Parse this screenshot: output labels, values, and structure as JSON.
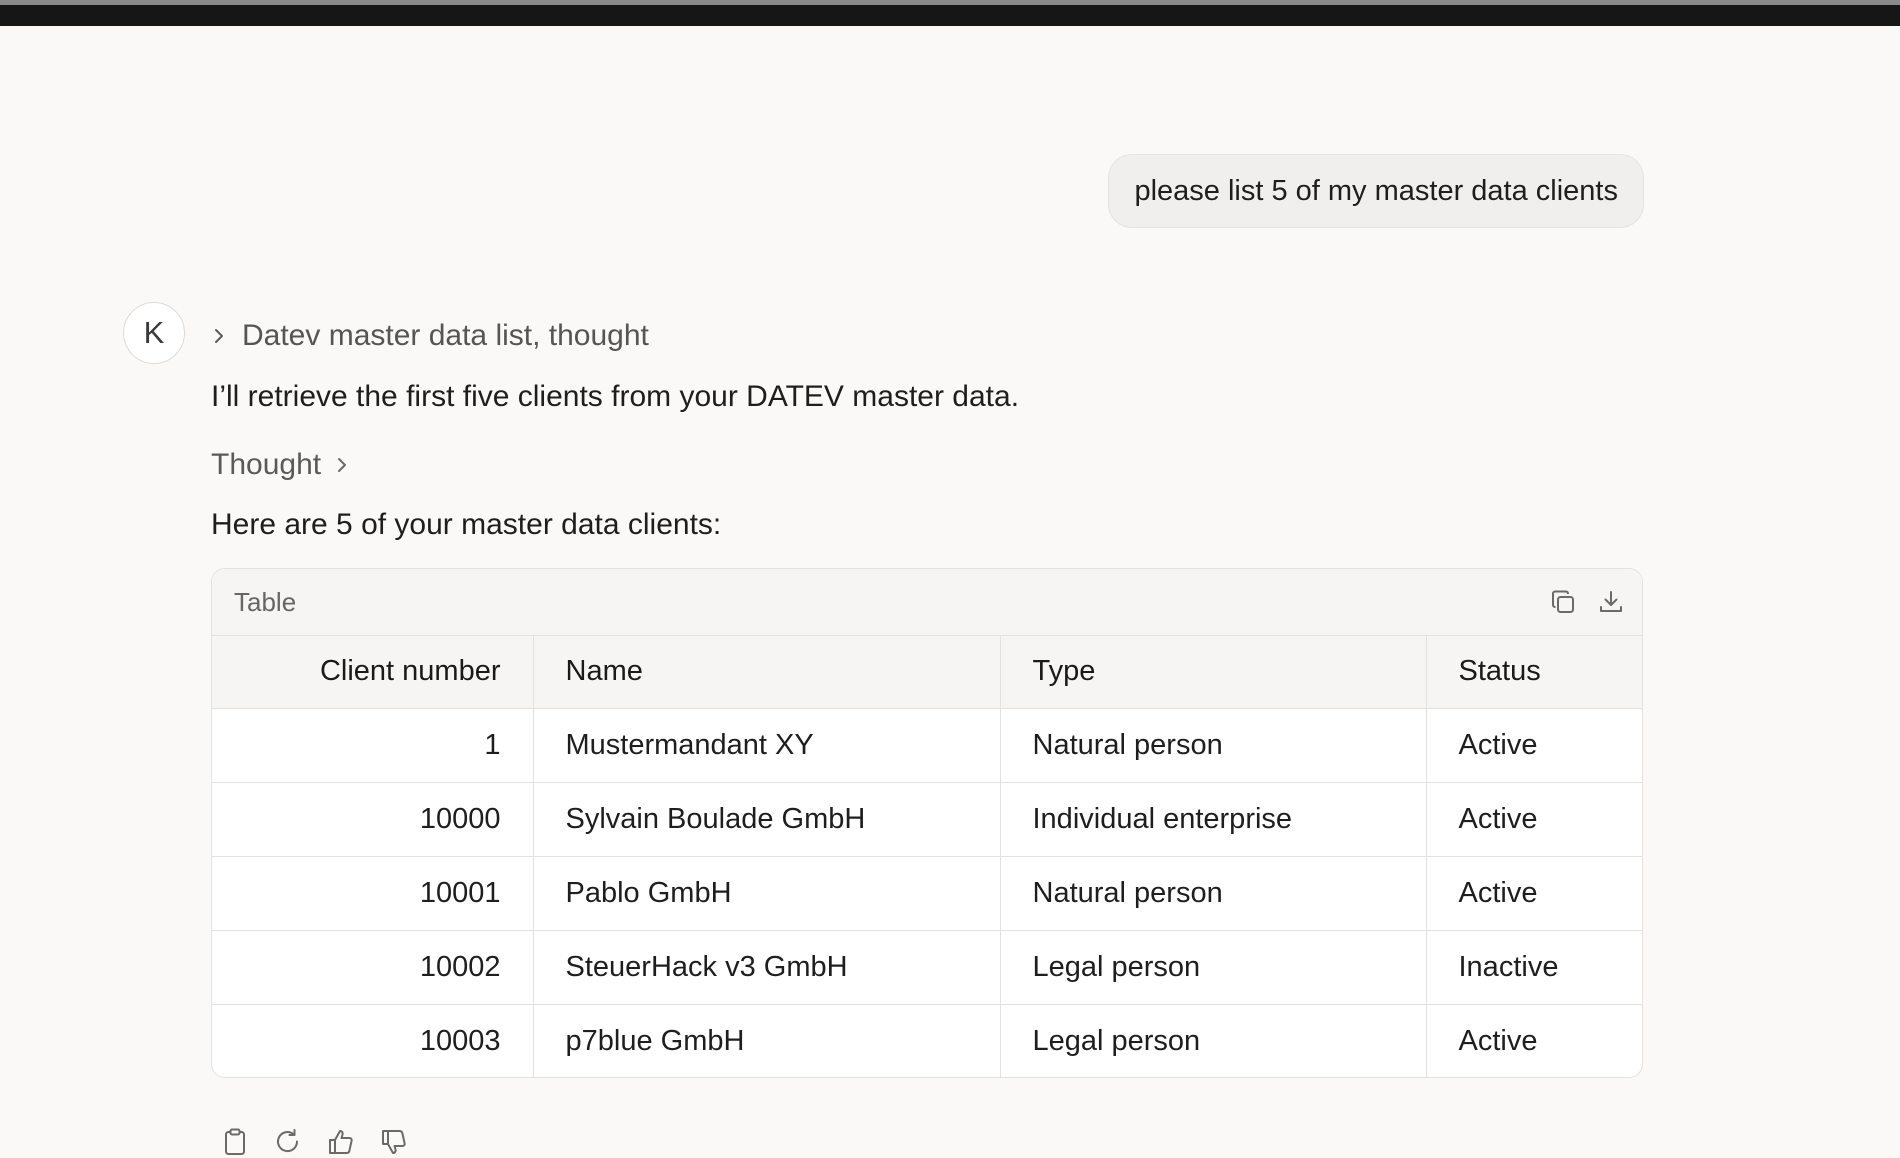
{
  "user_message": "please list 5 of my master data clients",
  "assistant": {
    "avatar_initial": "K",
    "tool_summary": "Datev master data list, thought",
    "intro_text": "I’ll retrieve the first five clients from your DATEV master data.",
    "thought_label": "Thought",
    "result_text": "Here are 5 of your master data clients:",
    "table": {
      "title": "Table",
      "columns": [
        "Client number",
        "Name",
        "Type",
        "Status"
      ],
      "rows": [
        {
          "client_number": "1",
          "name": "Mustermandant XY",
          "type": "Natural person",
          "status": "Active"
        },
        {
          "client_number": "10000",
          "name": "Sylvain Boulade GmbH",
          "type": "Individual enterprise",
          "status": "Active"
        },
        {
          "client_number": "10001",
          "name": "Pablo GmbH",
          "type": "Natural person",
          "status": "Active"
        },
        {
          "client_number": "10002",
          "name": "SteuerHack v3 GmbH",
          "type": "Legal person",
          "status": "Inactive"
        },
        {
          "client_number": "10003",
          "name": "p7blue GmbH",
          "type": "Legal person",
          "status": "Active"
        }
      ]
    },
    "feedback_icons": [
      "clipboard-icon",
      "retry-icon",
      "thumbs-up-icon",
      "thumbs-down-icon"
    ]
  },
  "colors": {
    "background": "#faf9f8",
    "topbar": "#161616",
    "border": "#e3e2df",
    "text": "#1e1e1e",
    "muted_text": "#5a5a57"
  }
}
